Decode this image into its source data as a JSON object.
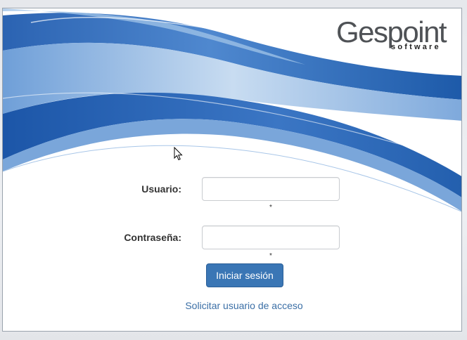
{
  "branding": {
    "logo_main": "Gespoint",
    "logo_sub": "software"
  },
  "form": {
    "username_label": "Usuario:",
    "username_value": "",
    "username_required": "*",
    "password_label": "Contraseña:",
    "password_value": "",
    "password_required": "*",
    "submit_label": "Iniciar sesión",
    "request_access_link": "Solicitar usuario de acceso"
  },
  "colors": {
    "accent": "#3a76b5",
    "link": "#3b6fa6",
    "wave_dark": "#1f5fb0",
    "wave_light": "#8fb6e0"
  },
  "icons": [
    "mouse-pointer-icon"
  ]
}
